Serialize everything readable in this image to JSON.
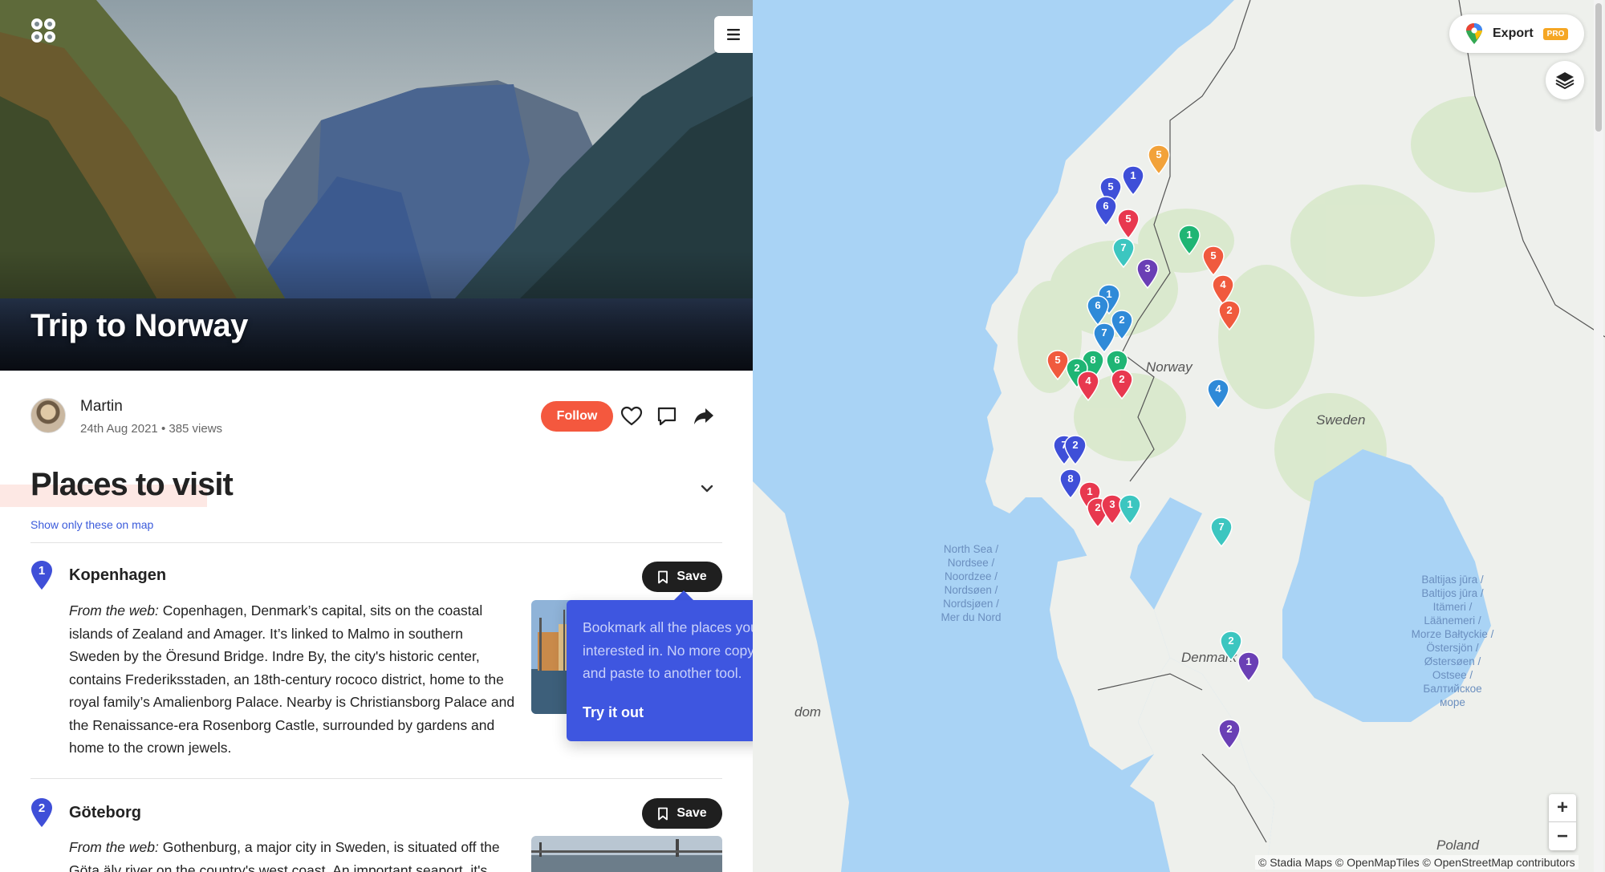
{
  "trip": {
    "title": "Trip to Norway",
    "author": "Martin",
    "date": "24th Aug 2021",
    "views": "385 views",
    "follow_label": "Follow"
  },
  "section": {
    "title": "Places to visit",
    "show_on_map": "Show only these on map"
  },
  "places": [
    {
      "number": "1",
      "name": "Kopenhagen",
      "save_label": "Save",
      "desc_prefix": "From the web:",
      "desc": "Copenhagen, Denmark’s capital, sits on the coastal islands of Zealand and Amager. It’s linked to Malmo in southern Sweden by the Öresund Bridge. Indre By, the city's historic center, contains Frederiksstaden, an 18th-century rococo district, home to the royal family’s Amalienborg Palace. Nearby is Christiansborg Palace and the Renaissance-era Rosenborg Castle, surrounded by gardens and home to the crown jewels."
    },
    {
      "number": "2",
      "name": "Göteborg",
      "save_label": "Save",
      "desc_prefix": "From the web:",
      "desc": "Gothenburg, a major city in Sweden, is situated off the Göta älv river on the country's west coast. An important seaport, it's"
    }
  ],
  "tooltip": {
    "text": "Bookmark all the places you’re interested in. No more copy and paste to another tool.",
    "cta": "Try it out"
  },
  "map": {
    "export_label": "Export",
    "pro_badge": "PRO",
    "zoom_in": "+",
    "zoom_out": "−",
    "attribution": "© Stadia Maps © OpenMapTiles © OpenStreetMap contributors",
    "labels": {
      "norway": "Norway",
      "sweden": "Sweden",
      "denmark": "Denmark",
      "poland": "Poland",
      "kingdom_partial": "dom",
      "north_sea": "North Sea / Nordsee / Noordzee / Nordsøen / Nordsjøen / Mer du Nord",
      "baltic_sea": "Baltijas jūra / Baltijos jūra / Itämeri / Läänemeri / Morze Bałtyckie / Östersjön / Østersøen / Ostsee / Балтийское море"
    },
    "pin_colors": {
      "red": "#e8384f",
      "orange": "#f05a3e",
      "yellow": "#f2a23a",
      "green": "#1fb574",
      "teal": "#3cc6c0",
      "blue": "#2f8ad8",
      "indigo": "#3f4fd8",
      "purple": "#6a3fb5"
    },
    "pins": [
      {
        "label": "5",
        "color": "yellow"
      },
      {
        "label": "1",
        "color": "indigo"
      },
      {
        "label": "5",
        "color": "indigo"
      },
      {
        "label": "6",
        "color": "indigo"
      },
      {
        "label": "5",
        "color": "red"
      },
      {
        "label": "1",
        "color": "green"
      },
      {
        "label": "5",
        "color": "orange"
      },
      {
        "label": "7",
        "color": "teal"
      },
      {
        "label": "4",
        "color": "orange"
      },
      {
        "label": "2",
        "color": "orange"
      },
      {
        "label": "3",
        "color": "purple"
      },
      {
        "label": "1",
        "color": "blue"
      },
      {
        "label": "6",
        "color": "blue"
      },
      {
        "label": "2",
        "color": "blue"
      },
      {
        "label": "7",
        "color": "blue"
      },
      {
        "label": "5",
        "color": "orange"
      },
      {
        "label": "8",
        "color": "green"
      },
      {
        "label": "6",
        "color": "green"
      },
      {
        "label": "2",
        "color": "green"
      },
      {
        "label": "4",
        "color": "red"
      },
      {
        "label": "2",
        "color": "red"
      },
      {
        "label": "4",
        "color": "blue"
      },
      {
        "label": "7",
        "color": "indigo"
      },
      {
        "label": "2",
        "color": "indigo"
      },
      {
        "label": "8",
        "color": "indigo"
      },
      {
        "label": "1",
        "color": "red"
      },
      {
        "label": "2",
        "color": "red"
      },
      {
        "label": "3",
        "color": "red"
      },
      {
        "label": "1",
        "color": "teal"
      },
      {
        "label": "7",
        "color": "teal"
      },
      {
        "label": "2",
        "color": "teal"
      },
      {
        "label": "1",
        "color": "purple"
      },
      {
        "label": "2",
        "color": "purple"
      }
    ]
  }
}
